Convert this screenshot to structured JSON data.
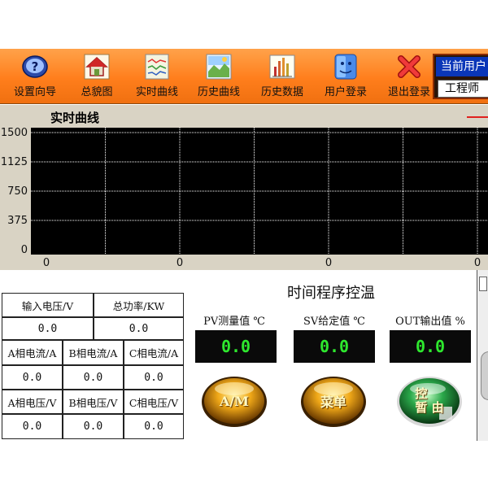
{
  "toolbar": {
    "items": [
      {
        "label": "设置向导"
      },
      {
        "label": "总貌图"
      },
      {
        "label": "实时曲线"
      },
      {
        "label": "历史曲线"
      },
      {
        "label": "历史数据"
      },
      {
        "label": "用户登录"
      },
      {
        "label": "退出登录"
      }
    ],
    "user_panel": {
      "title": "当前用户",
      "value": "工程师"
    }
  },
  "chart": {
    "title": "实时曲线"
  },
  "chart_data": {
    "type": "line",
    "title": "实时曲线",
    "y_ticks": [
      "1500",
      "1125",
      "750",
      "375",
      "0"
    ],
    "x_ticks": [
      "0",
      "0",
      "0",
      "0"
    ],
    "ylim": [
      0,
      1500
    ],
    "grid": true,
    "series": []
  },
  "table": {
    "headers": {
      "input_voltage": "输入电压/V",
      "total_power": "总功率/KW",
      "a_current": "A相电流/A",
      "b_current": "B相电流/A",
      "c_current": "C相电流/A",
      "a_voltage": "A相电压/V",
      "b_voltage": "B相电压/V",
      "c_voltage": "C相电压/V"
    },
    "values": {
      "input_voltage": "0.0",
      "total_power": "0.0",
      "a_current": "0.0",
      "b_current": "0.0",
      "c_current": "0.0",
      "a_voltage": "0.0",
      "b_voltage": "0.0",
      "c_voltage": "0.0"
    }
  },
  "controller": {
    "title": "时间程序控温",
    "pv_label": "PV测量值 ℃",
    "sv_label": "SV给定值 ℃",
    "out_label": "OUT输出值 %",
    "pv_value": "0.0",
    "sv_value": "0.0",
    "out_value": "0.0",
    "btn_am": "A/M",
    "btn_menu": "菜单",
    "btn_control": "控\n暂 由"
  },
  "colors": {
    "toolbar": "#ff8a2a",
    "user_title": "#0a36b8",
    "chart_bg": "#000000",
    "grid": "#ffffff",
    "display_text": "#2ee82e",
    "gold_button": "#e0a020",
    "green_button": "#2aa84a"
  }
}
